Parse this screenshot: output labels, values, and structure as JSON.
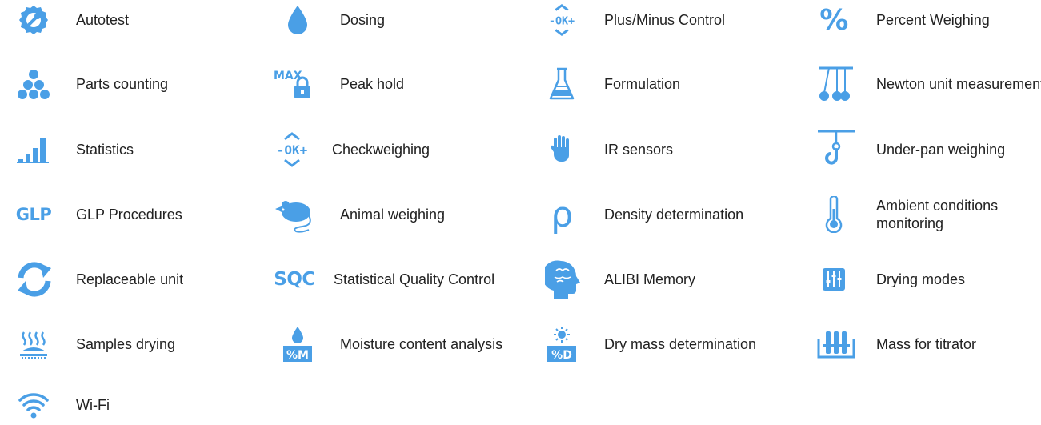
{
  "accent_color": "#4a9fe6",
  "features": [
    {
      "icon": "autotest-icon",
      "label": "Autotest"
    },
    {
      "icon": "dosing-icon",
      "label": "Dosing"
    },
    {
      "icon": "plus-minus-control-icon",
      "label": "Plus/Minus Control",
      "icon_text": "-OK+"
    },
    {
      "icon": "percent-icon",
      "label": "Percent Weighing",
      "icon_text": "%"
    },
    {
      "icon": "parts-counting-icon",
      "label": "Parts counting"
    },
    {
      "icon": "peak-hold-icon",
      "label": "Peak hold",
      "icon_text": "MAX"
    },
    {
      "icon": "formulation-icon",
      "label": "Formulation"
    },
    {
      "icon": "newton-unit-icon",
      "label": "Newton unit measurement"
    },
    {
      "icon": "statistics-icon",
      "label": "Statistics"
    },
    {
      "icon": "checkweighing-icon",
      "label": "Checkweighing",
      "icon_text": "-OK+"
    },
    {
      "icon": "ir-sensors-icon",
      "label": "IR sensors"
    },
    {
      "icon": "under-pan-weighing-icon",
      "label": "Under-pan weighing"
    },
    {
      "icon": "glp-icon",
      "label": "GLP Procedures",
      "icon_text": "GLP"
    },
    {
      "icon": "animal-weighing-icon",
      "label": "Animal weighing"
    },
    {
      "icon": "density-icon",
      "label": "Density determination",
      "icon_text": "ρ"
    },
    {
      "icon": "thermometer-icon",
      "label": "Ambient conditions monitoring"
    },
    {
      "icon": "replaceable-unit-icon",
      "label": "Replaceable unit"
    },
    {
      "icon": "sqc-icon",
      "label": "Statistical Quality Control",
      "icon_text": "SQC"
    },
    {
      "icon": "alibi-memory-icon",
      "label": "ALIBI Memory"
    },
    {
      "icon": "drying-modes-icon",
      "label": "Drying modes"
    },
    {
      "icon": "samples-drying-icon",
      "label": "Samples drying"
    },
    {
      "icon": "moisture-content-icon",
      "label": "Moisture content analysis",
      "icon_text": "%M"
    },
    {
      "icon": "dry-mass-icon",
      "label": "Dry mass determination",
      "icon_text": "%D"
    },
    {
      "icon": "mass-for-titrator-icon",
      "label": "Mass for titrator"
    },
    {
      "icon": "wifi-icon",
      "label": "Wi-Fi"
    }
  ]
}
